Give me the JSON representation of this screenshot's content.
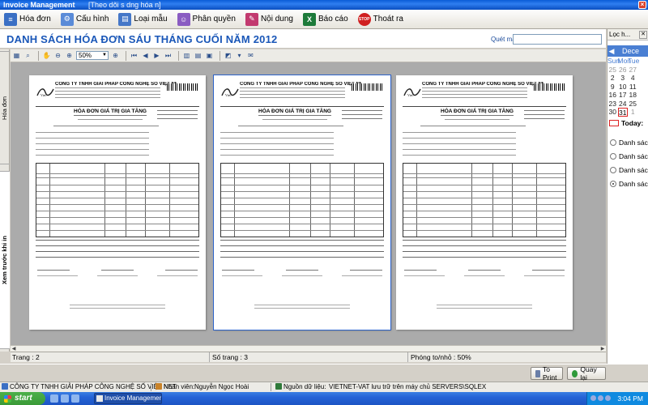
{
  "window": {
    "app_title": "Invoice Management",
    "title_extra": "[Theo dõi s­ d­ng hóa ­n]"
  },
  "toolbar": {
    "items": [
      {
        "label": "Hóa đơn",
        "icon": "invoice-icon",
        "color": "#3a6fc4"
      },
      {
        "label": "Cấu hình",
        "icon": "config-icon",
        "color": "#5a8bd8"
      },
      {
        "label": "Loại mẫu",
        "icon": "template-icon",
        "color": "#4577c8"
      },
      {
        "label": "Phân quyền",
        "icon": "permission-icon",
        "color": "#8a5cc2"
      },
      {
        "label": "Nội dung",
        "icon": "content-icon",
        "color": "#c23a6f"
      },
      {
        "label": "Báo cáo",
        "icon": "excel-report-icon",
        "color": "#1d7a3a"
      },
      {
        "label": "Thoát ra",
        "icon": "stop-icon",
        "color": "#d02020"
      }
    ]
  },
  "header": {
    "title": "DANH SÁCH HÓA ĐƠN SÁU THÁNG CUỐI NĂM 2012",
    "search_label": "Quét mã",
    "search_value": ""
  },
  "right_panel": {
    "header": "Lọc h...",
    "calendar": {
      "month": "Dece",
      "day_names": [
        "Sun",
        "Mon",
        "Tue"
      ],
      "rows": [
        [
          "25",
          "26",
          "27"
        ],
        [
          "2",
          "3",
          "4"
        ],
        [
          "9",
          "10",
          "11"
        ],
        [
          "16",
          "17",
          "18"
        ],
        [
          "23",
          "24",
          "25"
        ],
        [
          "30",
          "31",
          "1"
        ]
      ],
      "today_label": "Today:"
    },
    "radios": [
      {
        "label": "Danh sách",
        "selected": false
      },
      {
        "label": "Danh sách",
        "selected": false
      },
      {
        "label": "Danh sách",
        "selected": false
      },
      {
        "label": "Danh sách",
        "selected": true
      }
    ]
  },
  "left_tabs": {
    "invoice": "Hóa đơn",
    "preview": "Xem trước khi in"
  },
  "preview_toolbar": {
    "zoom": "50%"
  },
  "pages": [
    {
      "company": "CÔNG TY TNHH GIẢI PHÁP CÔNG NGHỆ SỐ VIỆT NET",
      "title": "HÓA ĐƠN GIÁ TRỊ GIA TĂNG",
      "selected": false
    },
    {
      "company": "CÔNG TY TNHH GIẢI PHÁP CÔNG NGHỆ SỐ VIỆT NET",
      "title": "HÓA ĐƠN GIÁ TRỊ GIA TĂNG",
      "selected": true
    },
    {
      "company": "CÔNG TY TNHH GIẢI PHÁP CÔNG NGHỆ SỐ VIỆT NET",
      "title": "HÓA ĐƠN GIÁ TRỊ GIA TĂNG",
      "selected": false
    }
  ],
  "status": {
    "page": "Trang : 2",
    "total": "Số trang : 3",
    "zoom": "Phóng to/nhỏ : 50%"
  },
  "actions": {
    "print": "To Print",
    "back": "Quay lại"
  },
  "app_status": {
    "company": "CÔNG TY TNHH GIẢI PHÁP CÔNG NGHỆ SỐ VIỆT NET",
    "staff_label": "Nhân viên:",
    "staff_name": "Nguyễn Ngọc Hoài",
    "source_label": "Nguồn dữ liệu:",
    "source_value": "VIETNET-VAT lưu trữ trên máy chủ SERVERS\\SQLEX"
  },
  "taskbar": {
    "start": "start",
    "app": "Invoice Management ...",
    "clock": "3:04 PM"
  }
}
